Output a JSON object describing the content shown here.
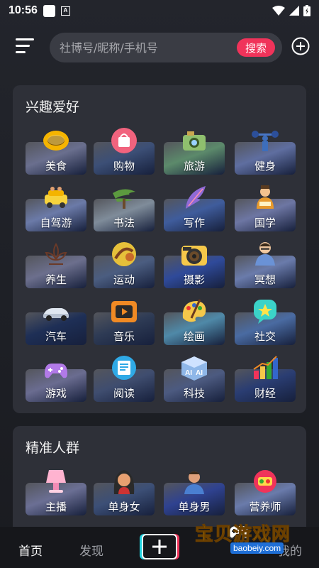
{
  "status_bar": {
    "time": "10:56",
    "a_badge": "A"
  },
  "search": {
    "placeholder": "社博号/昵称/手机号",
    "button_label": "搜索"
  },
  "sections": [
    {
      "title": "兴趣爱好",
      "items": [
        {
          "label": "美食",
          "icon": "ring-icon",
          "tile": "#6a6f8e"
        },
        {
          "label": "购物",
          "icon": "shopping-bag-icon",
          "tile": "#3c4f76"
        },
        {
          "label": "旅游",
          "icon": "camera-icon",
          "tile": "#5c8a6b"
        },
        {
          "label": "健身",
          "icon": "weightlifter-icon",
          "tile": "#5f6ea0"
        },
        {
          "label": "自驾游",
          "icon": "car-icon",
          "tile": "#6b7aa8"
        },
        {
          "label": "书法",
          "icon": "pine-tree-icon",
          "tile": "#7f8c9a"
        },
        {
          "label": "写作",
          "icon": "feather-icon",
          "tile": "#3f5c9c"
        },
        {
          "label": "国学",
          "icon": "scholar-icon",
          "tile": "#6d76a3"
        },
        {
          "label": "养生",
          "icon": "lotus-icon",
          "tile": "#6c6f8d"
        },
        {
          "label": "运动",
          "icon": "gymnast-icon",
          "tile": "#4b5d80"
        },
        {
          "label": "摄影",
          "icon": "camera-lens-icon",
          "tile": "#2f4a9a"
        },
        {
          "label": "冥想",
          "icon": "meditation-icon",
          "tile": "#6a7bab"
        },
        {
          "label": "汽车",
          "icon": "sports-car-icon",
          "tile": "#1e2f56"
        },
        {
          "label": "音乐",
          "icon": "music-player-icon",
          "tile": "#2e3b55"
        },
        {
          "label": "绘画",
          "icon": "palette-icon",
          "tile": "#4f89a8"
        },
        {
          "label": "社交",
          "icon": "chat-star-icon",
          "tile": "#4a6ba2"
        },
        {
          "label": "游戏",
          "icon": "gamepad-icon",
          "tile": "#6a6c90"
        },
        {
          "label": "阅读",
          "icon": "book-icon",
          "tile": "#3f4d6f"
        },
        {
          "label": "科技",
          "icon": "ai-cube-icon",
          "tile": "#4c5a80"
        },
        {
          "label": "财经",
          "icon": "bar-chart-icon",
          "tile": "#2a3d72"
        }
      ]
    },
    {
      "title": "精准人群",
      "items": [
        {
          "label": "主播",
          "icon": "lamp-icon",
          "tile": "#6b6f94"
        },
        {
          "label": "单身女",
          "icon": "woman-portrait-icon",
          "tile": "#3c4f76"
        },
        {
          "label": "单身男",
          "icon": "man-portrait-icon",
          "tile": "#2f4290"
        },
        {
          "label": "营养师",
          "icon": "food-icon",
          "tile": "#6a7bab"
        }
      ]
    }
  ],
  "bottom_nav": {
    "home": "首页",
    "discover": "发现",
    "mine": "我的"
  },
  "watermark": {
    "title": "宝贝游戏网",
    "url": "baobeiy.com"
  },
  "colors": {
    "accent": "#f0335a",
    "card": "#2e3038",
    "background": "#23252c"
  }
}
